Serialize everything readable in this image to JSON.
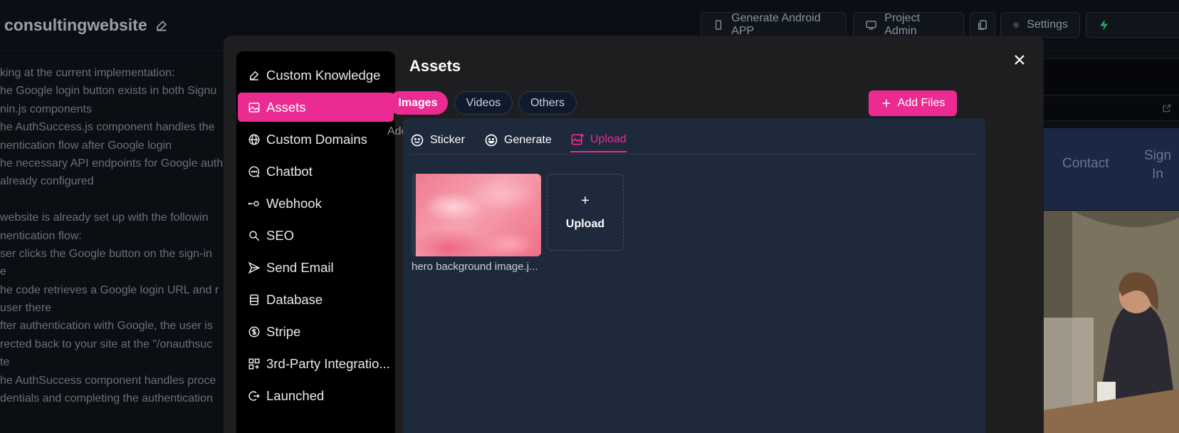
{
  "topbar": {
    "project_name": "consultingwebsite",
    "generate_app_label": "Generate Android APP",
    "project_admin_label": "Project Admin",
    "settings_label": "Settings"
  },
  "chat": {
    "lines": [
      "king at the current implementation:",
      "he Google login button exists in both Signu",
      "nin.js components",
      "he AuthSuccess.js component handles the",
      "nentication flow after Google login",
      "he necessary API endpoints for Google auth",
      "already configured",
      "",
      " website is already set up with the followin",
      "nentication flow:",
      "ser clicks the Google button on the sign-in",
      "e",
      "he code retrieves a Google login URL and r",
      "user there",
      "fter authentication with Google, the user is",
      "rected back to your site at the \"/onauthsuc",
      "te",
      "he AuthSuccess component handles proce",
      "dentials and completing the authentication"
    ]
  },
  "preview": {
    "nav_contact": "Contact",
    "nav_signin": "Sign In"
  },
  "modal": {
    "title": "Assets",
    "sidebar": [
      {
        "label": "Custom Knowledge",
        "icon": "pencil-icon"
      },
      {
        "label": "Assets",
        "icon": "image-icon"
      },
      {
        "label": "Custom Domains",
        "icon": "globe-icon"
      },
      {
        "label": "Chatbot",
        "icon": "chat-bubble-icon"
      },
      {
        "label": "Webhook",
        "icon": "webhook-icon"
      },
      {
        "label": "SEO",
        "icon": "search-icon"
      },
      {
        "label": "Send Email",
        "icon": "send-icon"
      },
      {
        "label": "Database",
        "icon": "database-icon"
      },
      {
        "label": "Stripe",
        "icon": "dollar-icon"
      },
      {
        "label": "3rd-Party Integratio...",
        "icon": "grid-plus-icon"
      },
      {
        "label": "Launched",
        "icon": "logout-icon"
      }
    ],
    "filters": [
      "Images",
      "Videos",
      "Others"
    ],
    "add_files_label": "Add Files",
    "add_text": "Adc",
    "panel": {
      "tabs": [
        "Sticker",
        "Generate",
        "Upload"
      ],
      "file_name": "hero background image.j...",
      "upload_label": "Upload",
      "upload_plus": "+"
    }
  },
  "colors": {
    "accent": "#ec2b92",
    "panel_bg": "#1e293b",
    "modal_bg": "#1e1e21"
  }
}
